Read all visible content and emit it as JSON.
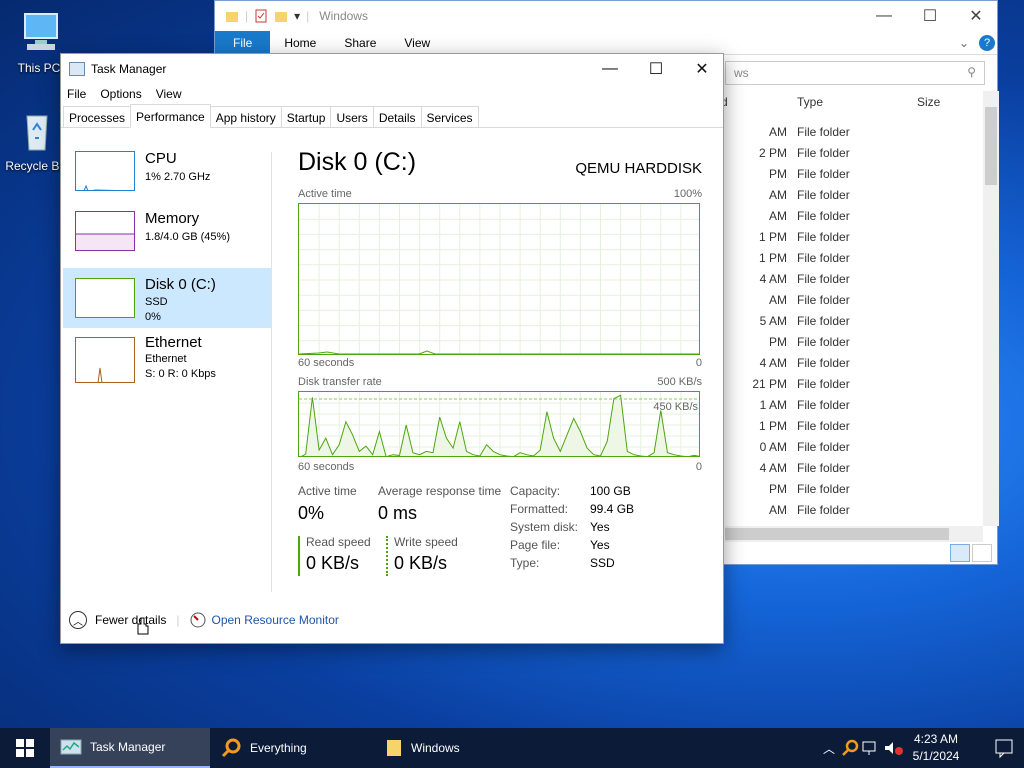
{
  "desktop": {
    "icons": [
      {
        "label": "This PC"
      },
      {
        "label": "Recycle Bin"
      }
    ]
  },
  "explorer": {
    "title": "Windows",
    "ribbon_tabs": [
      "File",
      "Home",
      "Share",
      "View"
    ],
    "search_placeholder": "ws",
    "col_type": "Type",
    "col_size": "Size",
    "col_date_fragment": "d",
    "rows": [
      {
        "date": "AM",
        "type": "File folder"
      },
      {
        "date": "2 PM",
        "type": "File folder"
      },
      {
        "date": "PM",
        "type": "File folder"
      },
      {
        "date": "AM",
        "type": "File folder"
      },
      {
        "date": "AM",
        "type": "File folder"
      },
      {
        "date": "1 PM",
        "type": "File folder"
      },
      {
        "date": "1 PM",
        "type": "File folder"
      },
      {
        "date": "4 AM",
        "type": "File folder"
      },
      {
        "date": "AM",
        "type": "File folder"
      },
      {
        "date": "5 AM",
        "type": "File folder"
      },
      {
        "date": "PM",
        "type": "File folder"
      },
      {
        "date": "4 AM",
        "type": "File folder"
      },
      {
        "date": "21 PM",
        "type": "File folder"
      },
      {
        "date": "1 AM",
        "type": "File folder"
      },
      {
        "date": "1 PM",
        "type": "File folder"
      },
      {
        "date": "0 AM",
        "type": "File folder"
      },
      {
        "date": "4 AM",
        "type": "File folder"
      },
      {
        "date": "PM",
        "type": "File folder"
      },
      {
        "date": "AM",
        "type": "File folder"
      }
    ]
  },
  "taskmgr": {
    "title": "Task Manager",
    "menu": [
      "File",
      "Options",
      "View"
    ],
    "tabs": [
      "Processes",
      "Performance",
      "App history",
      "Startup",
      "Users",
      "Details",
      "Services"
    ],
    "active_tab": "Performance",
    "sidebar": [
      {
        "name": "CPU",
        "line1": "1% 2.70 GHz",
        "line2": "",
        "color": "#1e80d6"
      },
      {
        "name": "Memory",
        "line1": "1.8/4.0 GB (45%)",
        "line2": "",
        "color": "#8b2fa8"
      },
      {
        "name": "Disk 0 (C:)",
        "line1": "SSD",
        "line2": "0%",
        "color": "#4da60c"
      },
      {
        "name": "Ethernet",
        "line1": "Ethernet",
        "line2": "S: 0 R: 0 Kbps",
        "color": "#a7641a"
      }
    ],
    "main": {
      "title": "Disk 0 (C:)",
      "model": "QEMU HARDDISK",
      "graph1_label": "Active time",
      "graph1_max": "100%",
      "graph1_xlabel": "60 seconds",
      "graph1_xend": "0",
      "graph2_label": "Disk transfer rate",
      "graph2_max": "500 KB/s",
      "graph2_mark": "450 KB/s",
      "graph2_xlabel": "60 seconds",
      "graph2_xend": "0",
      "active_time_label": "Active time",
      "active_time_value": "0%",
      "avg_resp_label": "Average response time",
      "avg_resp_value": "0 ms",
      "read_label": "Read speed",
      "read_value": "0 KB/s",
      "write_label": "Write speed",
      "write_value": "0 KB/s",
      "props": [
        {
          "k": "Capacity:",
          "v": "100 GB"
        },
        {
          "k": "Formatted:",
          "v": "99.4 GB"
        },
        {
          "k": "System disk:",
          "v": "Yes"
        },
        {
          "k": "Page file:",
          "v": "Yes"
        },
        {
          "k": "Type:",
          "v": "SSD"
        }
      ],
      "transfer_series": [
        0,
        0.06,
        0.92,
        0.12,
        0.3,
        0.05,
        0.2,
        0.55,
        0.35,
        0.1,
        0.18,
        0.05,
        0.4,
        0.02,
        0.05,
        0.04,
        0.5,
        0.08,
        0.05,
        0.1,
        0.08,
        0.62,
        0.3,
        0.15,
        0.55,
        0.1,
        0.05,
        0.03,
        0.2,
        0.1,
        0.05,
        0.03,
        0.02,
        0.08,
        0.05,
        0.03,
        0.12,
        0.7,
        0.3,
        0.1,
        0.35,
        0.6,
        0.4,
        0.15,
        0.05,
        0.03,
        0.25,
        0.9,
        0.95,
        0.1,
        0.05,
        0.03,
        0.02,
        0.08,
        0.72,
        0.08,
        0.05,
        0.03,
        0.02,
        0.04,
        0.02
      ]
    },
    "fewer_details": "Fewer details",
    "open_resmon": "Open Resource Monitor"
  },
  "taskbar": {
    "items": [
      "Task Manager",
      "Everything",
      "Windows"
    ],
    "time": "4:23 AM",
    "date": "5/1/2024"
  }
}
